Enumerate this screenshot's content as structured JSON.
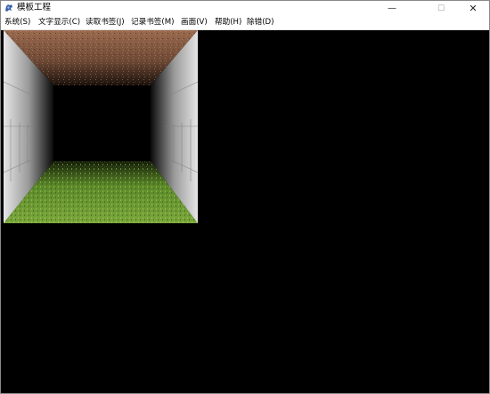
{
  "window": {
    "title": "模板工程",
    "icon": "dragon-app-icon",
    "controls": {
      "minimize": "—",
      "maximize": "☐",
      "close": "✕"
    }
  },
  "menu": [
    {
      "label": "系统(S)"
    },
    {
      "label": "文字显示(C)"
    },
    {
      "label": "读取书签(J)"
    },
    {
      "label": "记录书签(M)"
    },
    {
      "label": "画面(V)"
    },
    {
      "label": "帮助(H)"
    },
    {
      "label": "除错(D)"
    }
  ],
  "scene": {
    "type": "first-person-3d-corridor",
    "ceiling_texture": "brown-dirt",
    "floor_texture": "green-grass",
    "wall_texture": "grey-stone-panels",
    "colors": {
      "ceiling": "#8a5c44",
      "floor": "#6e9a34",
      "wall_light": "#d8d8d8",
      "background": "#000000"
    }
  }
}
